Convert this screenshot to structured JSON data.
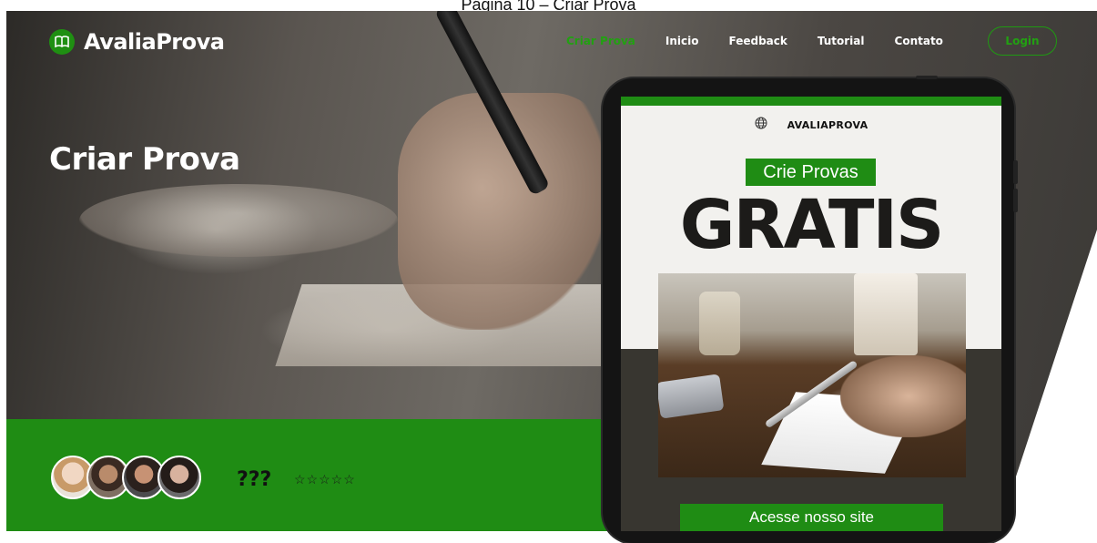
{
  "page_caption": "Página 10 – Criar Prova",
  "header": {
    "logo_icon": "open-book-icon",
    "logo_text": "AvaliaProva",
    "nav": [
      {
        "label": "Criar Prova",
        "active": true
      },
      {
        "label": "Inicio",
        "active": false
      },
      {
        "label": "Feedback",
        "active": false
      },
      {
        "label": "Tutorial",
        "active": false
      },
      {
        "label": "Contato",
        "active": false
      }
    ],
    "login_label": "Login"
  },
  "hero": {
    "title": "Criar Prova"
  },
  "rating": {
    "text": "???",
    "stars": "☆☆☆☆☆",
    "star_count": 5,
    "avatar_count": 4
  },
  "promo": {
    "brand": "AVALIAPROVA",
    "globe_icon": "globe-icon",
    "badge": "Crie Provas",
    "headline": "GRATIS",
    "cta": "Acesse nosso site"
  },
  "colors": {
    "accent": "#1f8c14",
    "active_nav": "#22a012"
  }
}
